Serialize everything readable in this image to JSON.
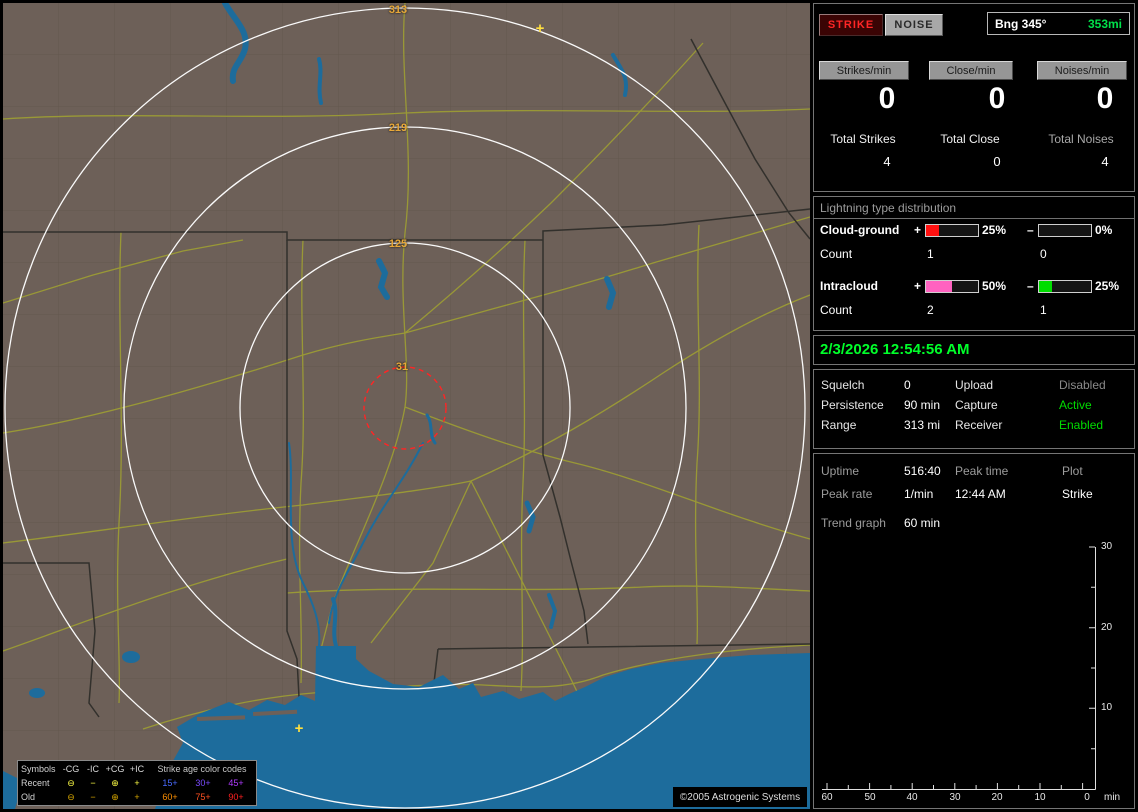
{
  "colors": {
    "datetime_green": "#00ff2a",
    "status_green": "#00dd00",
    "status_gray": "#8a8a8a",
    "bearing_green": "#00e04a",
    "ring_label": "#e8a838",
    "strike_marker": "#ffdf40"
  },
  "map": {
    "ring_labels": [
      "313",
      "219",
      "125",
      "31"
    ],
    "strike_markers": [
      "+",
      "+"
    ],
    "copyright": "©2005 Astrogenic Systems",
    "legend": {
      "symbols_header": "Symbols",
      "type_labels": [
        "-CG",
        "-IC",
        "+CG",
        "+IC"
      ],
      "age_header": "Strike age color codes",
      "symbol_glyphs": [
        "⊖",
        "−",
        "⊕",
        "+"
      ],
      "rows": [
        {
          "label": "Recent",
          "symbol_color": "#ffff46",
          "ages": [
            {
              "text": "15+",
              "color": "#4a6bff"
            },
            {
              "text": "30+",
              "color": "#7a4bff"
            },
            {
              "text": "45+",
              "color": "#b03bff"
            }
          ]
        },
        {
          "label": "Old",
          "symbol_color": "#d8a800",
          "ages": [
            {
              "text": "60+",
              "color": "#ff9000"
            },
            {
              "text": "75+",
              "color": "#ff5020"
            },
            {
              "text": "90+",
              "color": "#ff2020"
            }
          ]
        }
      ]
    }
  },
  "panel": {
    "plot_buttons": {
      "strike": "STRIKE",
      "noise": "NOISE"
    },
    "bearing": {
      "label": "Bng 345°",
      "value": "353mi"
    },
    "rates": [
      {
        "label": "Strikes/min",
        "value": "0"
      },
      {
        "label": "Close/min",
        "value": "0"
      },
      {
        "label": "Noises/min",
        "value": "0"
      }
    ],
    "totals": [
      {
        "label": "Total Strikes",
        "value": "4",
        "label_color": "#efefef"
      },
      {
        "label": "Total Close",
        "value": "0",
        "label_color": "#efefef"
      },
      {
        "label": "Total Noises",
        "value": "4",
        "label_color": "#a8a8a8"
      }
    ],
    "distribution": {
      "title": "Lightning type distribution",
      "count_label": "Count",
      "rows": [
        {
          "name": "Cloud-ground",
          "plus_sign": "+",
          "plus_pct": "25%",
          "plus_fill": 25,
          "plus_color": "#ff1010",
          "minus_sign": "–",
          "minus_pct": "0%",
          "minus_fill": 0,
          "minus_color": "#00d000",
          "plus_count": "1",
          "minus_count": "0"
        },
        {
          "name": "Intracloud",
          "plus_sign": "+",
          "plus_pct": "50%",
          "plus_fill": 50,
          "plus_color": "#ff62c0",
          "minus_sign": "–",
          "minus_pct": "25%",
          "minus_fill": 25,
          "minus_color": "#00dd00",
          "plus_count": "2",
          "minus_count": "1"
        }
      ]
    },
    "datetime": "2/3/2026 12:54:56 AM",
    "status": {
      "rows": [
        {
          "l1": "Squelch",
          "v1": "0",
          "l2": "Upload",
          "v2": "Disabled",
          "v2_color": "#8a8a8a"
        },
        {
          "l1": "Persistence",
          "v1": "90 min",
          "l2": "Capture",
          "v2": "Active",
          "v2_color": "#00dd00"
        },
        {
          "l1": "Range",
          "v1": "313 mi",
          "l2": "Receiver",
          "v2": "Enabled",
          "v2_color": "#00dd00"
        }
      ]
    },
    "stats": {
      "uptime_label": "Uptime",
      "uptime_value": "516:40",
      "peak_time_label": "Peak time",
      "plot_label": "Plot",
      "peak_rate_label": "Peak rate",
      "peak_rate_value": "1/min",
      "peak_time_value": "12:44 AM",
      "plot_value": "Strike",
      "trend_label": "Trend graph",
      "trend_value": "60 min"
    },
    "trend_graph": {
      "y_ticks": [
        "30",
        "20",
        "10"
      ],
      "x_ticks": [
        "60",
        "50",
        "40",
        "30",
        "20",
        "10",
        "0"
      ],
      "origin_unit": "min"
    }
  }
}
